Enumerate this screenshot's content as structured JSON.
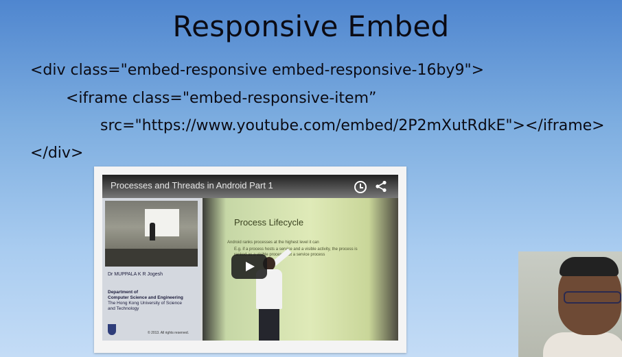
{
  "slide": {
    "title": "Responsive Embed",
    "code_lines": [
      "<div class=\"embed-responsive embed-responsive-16by9\">",
      "<iframe class=\"embed-responsive-item”",
      "src=\"https://www.youtube.com/embed/2P2mXutRdkE\"></iframe>",
      "</div>"
    ]
  },
  "video": {
    "title": "Processes and Threads in Android Part 1",
    "icons": [
      "clock-icon",
      "share-icon",
      "play-icon"
    ],
    "lecture_pane": {
      "lecturer": "Dr MUPPALA K R Jogesh",
      "department_lines": [
        "Department of",
        "Computer Science and Engineering"
      ],
      "university_lines": [
        "The Hong Kong University of Science",
        "and Technology"
      ],
      "copyright": "© 2013. All rights reserved."
    },
    "projected_slide": {
      "title": "Process Lifecycle",
      "bullets": [
        "Android ranks processes at the highest level it can",
        "E.g. if a process hosts a service and a visible activity, the process is",
        "ranked as a visible process, not a service process"
      ]
    }
  },
  "colors": {
    "background_top": "#4f86cf",
    "background_bottom": "#c4dcf6",
    "text": "#0b0b14"
  }
}
